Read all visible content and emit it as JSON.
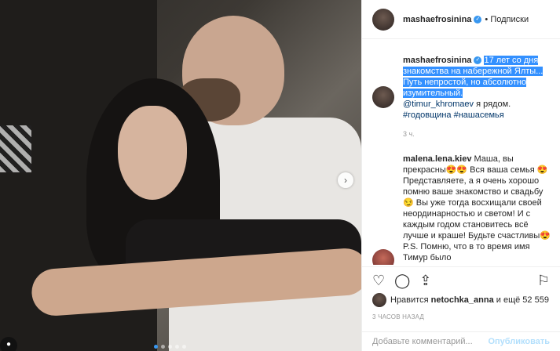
{
  "post": {
    "username": "mashaefrosinina",
    "follow_label": "• Подписки",
    "caption_highlight": "17 лет со дня знакомства на набережной Ялты... Путь непростой, но абсолютно изумительный.",
    "caption_mention": "@timur_khromaev",
    "caption_rest": " я рядом.",
    "hashtags": "#годовщина #нашасемья",
    "caption_time": "3 ч."
  },
  "comment2": {
    "username": "malena.lena.kiev",
    "text": "Маша, вы прекрасны😍😍 Вся ваша семья 😍 Представляете, а я очень хорошо помню ваше знакомство и свадьбу😏 Вы уже тогда восхищали своей неординарностью и светом! И с каждым годом становитесь всё лучше и краше! Будьте счастливы😍 P.S. Помню, что в то время имя Тимур было"
  },
  "actions": {
    "like_icon": "heart-icon",
    "comment_icon": "comment-icon",
    "share_icon": "share-icon",
    "bookmark_icon": "bookmark-icon"
  },
  "likes": {
    "prefix": "Нравится ",
    "user": "netochka_anna",
    "suffix": " и ещё 52 559"
  },
  "timestamp": "3 ЧАСОВ НАЗАД",
  "add_comment": {
    "placeholder": "Добавьте комментарий...",
    "publish_label": "Опубликовать"
  },
  "carousel": {
    "count": 5,
    "active_index": 0
  },
  "colors": {
    "accent": "#3897f0",
    "highlight": "#3390ff"
  }
}
